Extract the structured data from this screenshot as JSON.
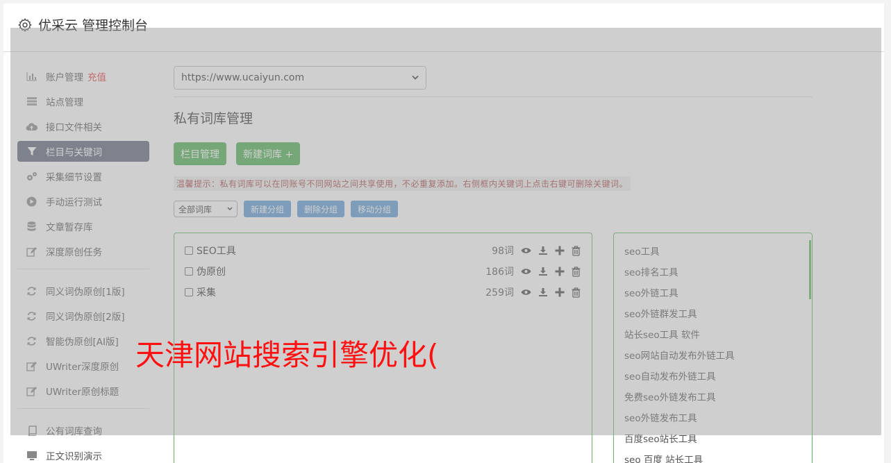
{
  "header": {
    "title": "优采云 管理控制台"
  },
  "sidebar": {
    "group1": [
      {
        "label": "账户管理",
        "badge": "充值",
        "icon": "bar-chart-icon"
      },
      {
        "label": "站点管理",
        "icon": "server-icon"
      },
      {
        "label": "接口文件相关",
        "icon": "cloud-upload-icon"
      },
      {
        "label": "栏目与关键词",
        "icon": "filter-icon",
        "active": true
      },
      {
        "label": "采集细节设置",
        "icon": "gears-icon"
      },
      {
        "label": "手动运行测试",
        "icon": "play-circle-icon"
      },
      {
        "label": "文章暂存库",
        "icon": "database-icon"
      },
      {
        "label": "深度原创任务",
        "icon": "edit-icon"
      }
    ],
    "group2": [
      {
        "label": "同义词伪原创[1版]",
        "icon": "refresh-icon"
      },
      {
        "label": "同义词伪原创[2版]",
        "icon": "refresh-icon"
      },
      {
        "label": "智能伪原创[AI版]",
        "icon": "refresh-icon"
      },
      {
        "label": "UWriter深度原创",
        "icon": "edit-icon"
      },
      {
        "label": "UWriter原创标题",
        "icon": "edit-icon"
      }
    ],
    "group3": [
      {
        "label": "公有词库查询",
        "icon": "book-icon"
      },
      {
        "label": "正文识别演示",
        "icon": "monitor-icon"
      }
    ]
  },
  "main": {
    "site_select": "https://www.ucaiyun.com",
    "title": "私有词库管理",
    "btn_column": "栏目管理",
    "btn_new_lib": "新建词库 +",
    "tip": "温馨提示：私有词库可以在同账号不同网站之间共享使用，不必重复添加。右侧框内关键词上点击右键可删除关键词。",
    "filter_select": "全部词库",
    "btn_new_group": "新建分组",
    "btn_delete_group": "删除分组",
    "btn_move_group": "移动分组",
    "libraries": [
      {
        "name": "SEO工具",
        "count": "98词"
      },
      {
        "name": "伪原创",
        "count": "186词"
      },
      {
        "name": "采集",
        "count": "259词"
      }
    ],
    "keywords": [
      "seo工具",
      "seo排名工具",
      "seo外链工具",
      "seo外链群发工具",
      "站长seo工具 软件",
      "seo网站自动发布外链工具",
      "seo自动发布外链工具",
      "免费seo外链发布工具",
      "seo外链发布工具",
      "百度seo站长工具",
      "seo 百度 站长工具"
    ]
  },
  "watermark": "天津网站搜索引擎优化(",
  "colors": {
    "accent_green": "#4caf50",
    "active_nav": "#5a6478",
    "blue_button": "#5b9bd5",
    "tip_red": "#a94442"
  }
}
